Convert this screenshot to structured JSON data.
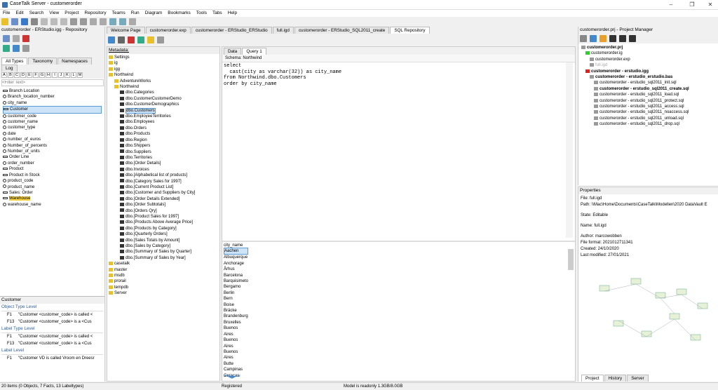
{
  "window": {
    "title": "CaseTalk Server - customerorder"
  },
  "menu": [
    "File",
    "Edit",
    "Search",
    "View",
    "Project",
    "Repository",
    "Teams",
    "Run",
    "Diagram",
    "Bookmarks",
    "Tools",
    "Tabs",
    "Help"
  ],
  "left": {
    "header": "customerorder - ERStudio.igg - Repository",
    "tabs": [
      "All Types",
      "Taxonomy",
      "Namespaces",
      "Log"
    ],
    "letters": [
      "A",
      "B",
      "C",
      "D",
      "E",
      "F",
      "G",
      "H",
      "I",
      "J",
      "K",
      "L",
      "M"
    ],
    "filter_placeholder": "<Filter Text>",
    "items": [
      "Branch Location",
      "Branch_location_number",
      "city_name",
      "Customer",
      "customer_code",
      "customer_name",
      "customer_type",
      "date",
      "number_of_euros",
      "Number_of_percents",
      "Number_of_units",
      "Order Line",
      "order_number",
      "Product",
      "Product in Stock",
      "product_code",
      "product_name",
      "Sales: Order",
      "Warehouse",
      "warehouse_name"
    ],
    "bottom_title": "Customer",
    "sections": [
      {
        "title": "Object Type Level",
        "rows": [
          {
            "code": "F1",
            "text": "\"Customer <customer_code> is called <"
          },
          {
            "code": "F13",
            "text": "\"Customer <customer_code> is a <Cus"
          }
        ]
      },
      {
        "title": "Label Type Level",
        "rows": [
          {
            "code": "F1",
            "text": "\"Customer <customer_code> is called <"
          },
          {
            "code": "F13",
            "text": "\"Customer <customer_code> is a <Cus"
          }
        ]
      },
      {
        "title": "Label Level",
        "rows": [
          {
            "code": "F1",
            "text": "\"Customer VD is called Vroom en Dreesr"
          }
        ]
      }
    ]
  },
  "doc_tabs": [
    "Welcome Page",
    "customerorder.exp",
    "customerorder - ERStudio_ERStudio",
    "full.igd",
    "customerorder - ERStudio_SQL2011_create",
    "SQL Repository"
  ],
  "metadata": {
    "header": "Metadata:",
    "items": [
      "Settings",
      "ig",
      "igg",
      "Northwind",
      "AdventureWorks",
      "Northwind",
      "dbo.Categories",
      "dbo.CustomerCustomerDemo",
      "dbo.CustomerDemographics",
      "dbo.Customers",
      "dbo.EmployeeTerritories",
      "dbo.Employees",
      "dbo.Orders",
      "dbo.Products",
      "dbo.Region",
      "dbo.Shippers",
      "dbo.Suppliers",
      "dbo.Territories",
      "dbo.[Order Details]",
      "dbo.Invoices",
      "dbo.[Alphabetical list of products]",
      "dbo.[Category Sales for 1997]",
      "dbo.[Current Product List]",
      "dbo.[Customer and Suppliers by City]",
      "dbo.[Order Details Extended]",
      "dbo.[Order Subtotals]",
      "dbo.[Orders Qry]",
      "dbo.[Product Sales for 1997]",
      "dbo.[Products Above Average Price]",
      "dbo.[Products by Category]",
      "dbo.[Quarterly Orders]",
      "dbo.[Sales Totals by Amount]",
      "dbo.[Sales by Category]",
      "dbo.[Summary of Sales by Quarter]",
      "dbo.[Summary of Sales by Year]",
      "casetalk",
      "master",
      "msdb",
      "prorail",
      "tempdb",
      "Server"
    ]
  },
  "query": {
    "tabs": [
      "Data",
      "Query 1"
    ],
    "schema": "Schema: Northwind",
    "lines": [
      [
        "select",
        ""
      ],
      [
        "  cast(city as varchar(32)) as city_name",
        ""
      ],
      [
        "from Northwind.dbo.Customers",
        ""
      ],
      [
        "order by city_name",
        ""
      ]
    ],
    "column": "city_name",
    "results": [
      "Aachen",
      "Albuquerque",
      "Anchorage",
      "Århus",
      "Barcelona",
      "Barquisimeto",
      "Bergamo",
      "Berlin",
      "Bern",
      "Boise",
      "Bräcke",
      "Brandenburg",
      "Bruxelles",
      "Buenos Aires",
      "Buenos Aires",
      "Buenos Aires",
      "Butte",
      "Campinas",
      "Caracas"
    ]
  },
  "project": {
    "header": "customerorder.prj - Project Manager",
    "items": [
      "customerorder.prj",
      "customerorder.ig",
      "customerorder.exp",
      "full.igd",
      "customerorder - erstudio.igg",
      "customerorder - erstudio_erstudio.bas",
      "customerorder - erstudio_sql2011_init.sql",
      "customerorder - erstudio_sql2011_create.sql",
      "customerorder - erstudio_sql2011_load.sql",
      "customerorder - erstudio_sql2011_protect.sql",
      "customerorder - erstudio_sql2011_access.sql",
      "customerorder - erstudio_sql2011_noaccess.sql",
      "customerorder - erstudio_sql2011_unload.sql",
      "customerorder - erstudio_sql2011_drop.sql"
    ]
  },
  "properties": {
    "header": "Properties",
    "file": "File: full.igd",
    "path": "Path: \\\\Mac\\Home\\Documents\\CaseTalk\\Modellen\\2020 DataVault E",
    "state": "State: Editable",
    "name": "Name: full.igd",
    "author": "Author: marcowobben",
    "format": "File format: 2021012711341",
    "created": "Created: 24/10/2020",
    "modified": "Last modified: 27/01/2021",
    "tabs": [
      "Project",
      "History",
      "Server"
    ]
  },
  "status": {
    "left": "20 items (0 Objects, 7 Facts, 13 Labeltypes)",
    "mid": "Registered",
    "right": "Model is readonly   1.3GB/8.0GB"
  }
}
